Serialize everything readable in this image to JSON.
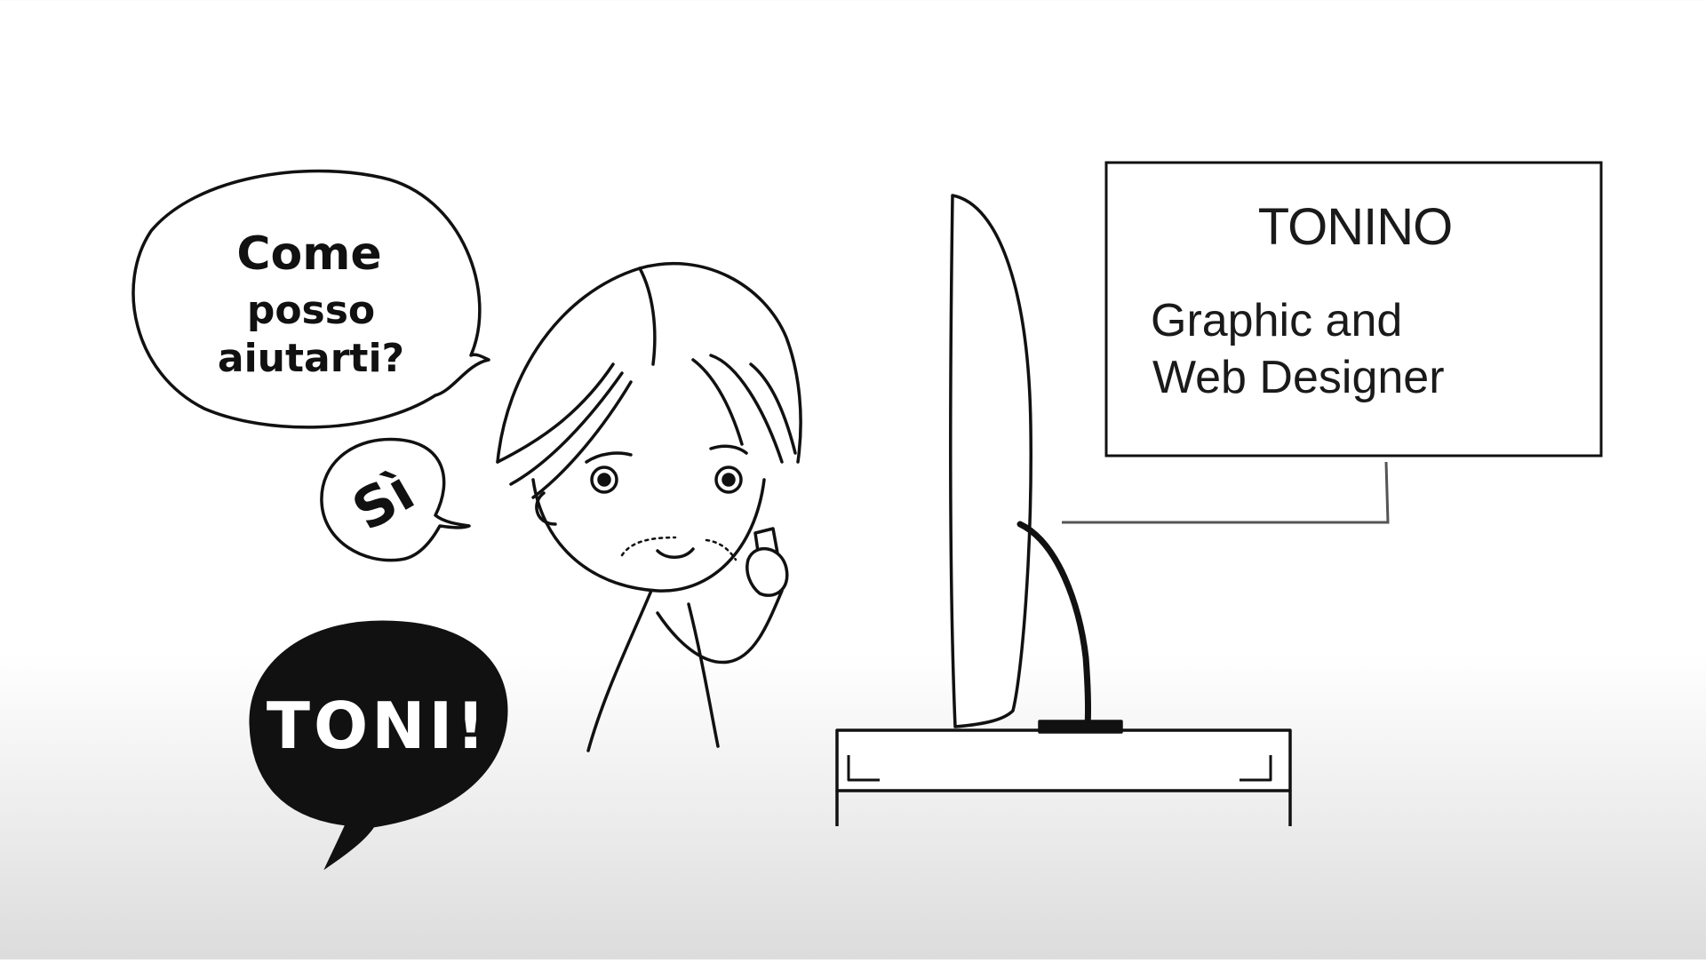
{
  "speech": {
    "question_line1": "Come",
    "question_line2": "posso",
    "question_line3": "aiutarti?",
    "reply": "Sì",
    "exclaim": "TONI!"
  },
  "sign": {
    "name": "TONINO",
    "role_line1": "Graphic and",
    "role_line2": "Web Designer"
  },
  "colors": {
    "ink": "#111111",
    "paper": "#ffffff",
    "floor_shade": "#dcdcdc"
  }
}
